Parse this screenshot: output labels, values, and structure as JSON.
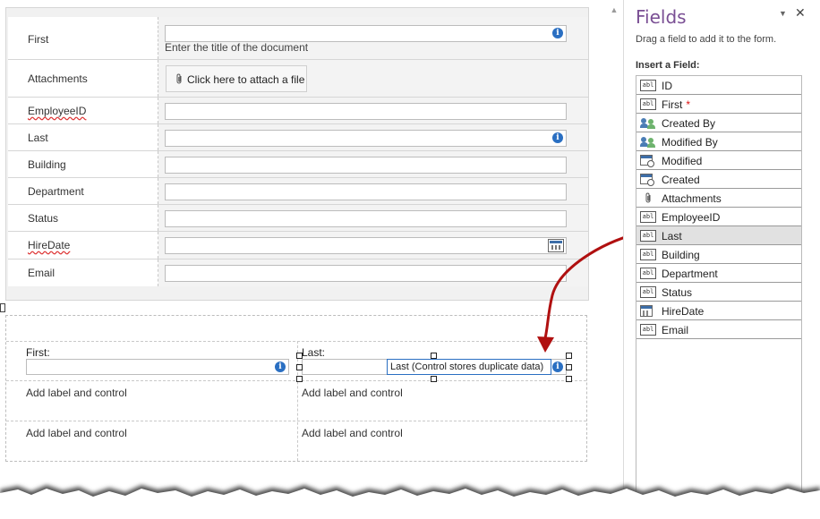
{
  "form": {
    "rows": [
      {
        "label": "First",
        "type": "text-info",
        "hint": "Enter the title of the document"
      },
      {
        "label": "Attachments",
        "type": "attach",
        "button_label": "Click here to attach a file"
      },
      {
        "label": "EmployeeID",
        "type": "text"
      },
      {
        "label": "Last",
        "type": "text-info"
      },
      {
        "label": "Building",
        "type": "text"
      },
      {
        "label": "Department",
        "type": "text"
      },
      {
        "label": "Status",
        "type": "text"
      },
      {
        "label": "HireDate",
        "type": "date"
      },
      {
        "label": "Email",
        "type": "text"
      }
    ],
    "bottom": {
      "first_label": "First:",
      "last_label": "Last:",
      "last_control_text": "Last (Control stores duplicate data)",
      "add_label_1": "Add label and control",
      "add_label_2": "Add label and control",
      "add_label_3": "Add label and control",
      "add_label_4": "Add label and control"
    }
  },
  "pane": {
    "title": "Fields",
    "description": "Drag a field to add it to the form.",
    "insert_label": "Insert a Field:",
    "fields": [
      {
        "name": "ID",
        "icon": "text-field-icon"
      },
      {
        "name": "First",
        "icon": "text-field-icon",
        "required": "*"
      },
      {
        "name": "Created By",
        "icon": "person-field-icon"
      },
      {
        "name": "Modified By",
        "icon": "person-field-icon"
      },
      {
        "name": "Modified",
        "icon": "datetime-field-icon"
      },
      {
        "name": "Created",
        "icon": "datetime-field-icon"
      },
      {
        "name": "Attachments",
        "icon": "paperclip-icon"
      },
      {
        "name": "EmployeeID",
        "icon": "text-field-icon"
      },
      {
        "name": "Last",
        "icon": "text-field-icon",
        "selected": true
      },
      {
        "name": "Building",
        "icon": "text-field-icon"
      },
      {
        "name": "Department",
        "icon": "text-field-icon"
      },
      {
        "name": "Status",
        "icon": "text-field-icon"
      },
      {
        "name": "HireDate",
        "icon": "calendar-field-icon"
      },
      {
        "name": "Email",
        "icon": "text-field-icon"
      }
    ]
  },
  "glyphs": {
    "info": "i",
    "clip": "⌀",
    "close": "✕",
    "menu": "▼",
    "scroll_up": "▲",
    "text_icon": "abl"
  },
  "colors": {
    "pane_title": "#7a4f94",
    "arrow": "#b01010",
    "selection_border": "#2a6fc2"
  }
}
